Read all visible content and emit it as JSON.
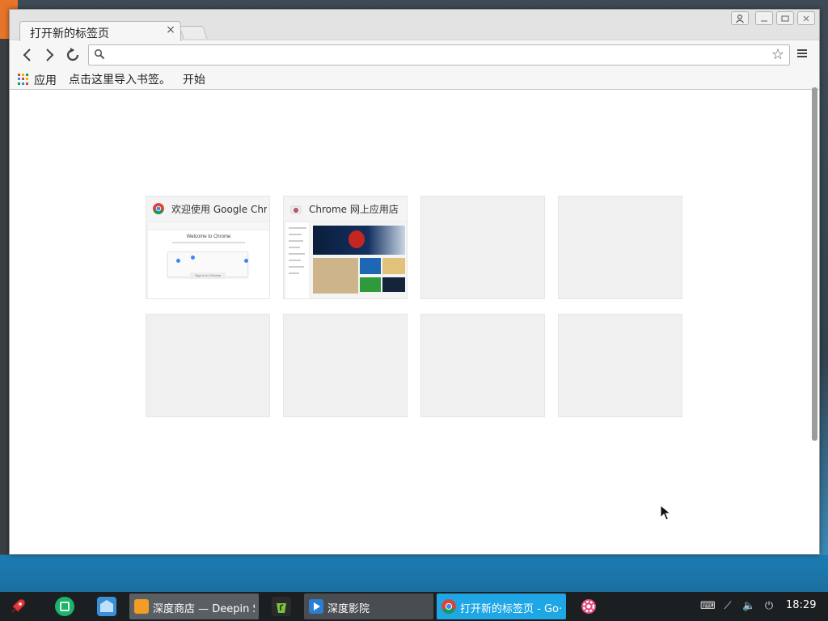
{
  "window": {
    "tab_title": "打开新的标签页",
    "tab_close": "×"
  },
  "omnibox": {
    "value": "",
    "placeholder": ""
  },
  "bookmarks": {
    "apps_label": "应用",
    "import_label": "点击这里导入书签。",
    "start_label": "开始"
  },
  "most_visited": [
    {
      "title": "欢迎使用 Google Chrome",
      "preview": "Welcome to Chrome"
    },
    {
      "title": "Chrome 网上应用店",
      "preview": ""
    },
    {
      "title": "",
      "preview": ""
    },
    {
      "title": "",
      "preview": ""
    },
    {
      "title": "",
      "preview": ""
    },
    {
      "title": "",
      "preview": ""
    },
    {
      "title": "",
      "preview": ""
    },
    {
      "title": "",
      "preview": ""
    }
  ],
  "welcome_preview": {
    "heading": "Welcome to Chrome",
    "button": "Sign in to Chrome"
  },
  "taskbar": {
    "items": [
      {
        "label": "深度商店 — Deepin S···"
      },
      {
        "label": "深度影院"
      },
      {
        "label": "打开新的标签页 - Go···"
      }
    ],
    "clock": "18:29"
  },
  "colors": {
    "accent": "#1ea7e4",
    "chrome_red": "#db4437",
    "chrome_yellow": "#f4b400",
    "chrome_green": "#0f9d58",
    "chrome_blue": "#4285f4"
  }
}
